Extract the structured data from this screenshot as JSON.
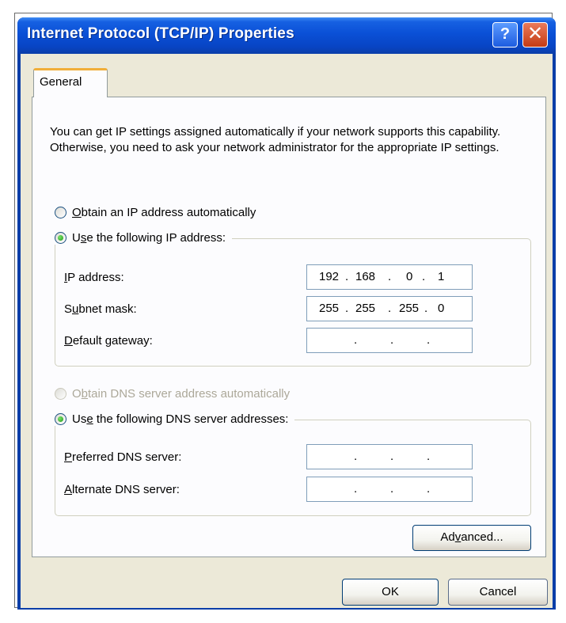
{
  "window": {
    "title": "Internet Protocol (TCP/IP) Properties",
    "help_glyph": "?",
    "close_glyph": "✕"
  },
  "tabs": [
    {
      "label": "General"
    }
  ],
  "description": "You can get IP settings assigned automatically if your network supports this capability. Otherwise, you need to ask your network administrator for the appropriate IP settings.",
  "ip": {
    "auto_label": {
      "pre": "",
      "key": "O",
      "post": "btain an IP address automatically"
    },
    "manual_label": {
      "pre": "U",
      "key": "s",
      "post": "e the following IP address:"
    },
    "fields": [
      {
        "label": {
          "pre": "",
          "key": "I",
          "post": "P address:"
        },
        "octets": [
          "192",
          "168",
          "0",
          "1"
        ]
      },
      {
        "label": {
          "pre": "S",
          "key": "u",
          "post": "bnet mask:"
        },
        "octets": [
          "255",
          "255",
          "255",
          "0"
        ]
      },
      {
        "label": {
          "pre": "",
          "key": "D",
          "post": "efault gateway:"
        },
        "octets": [
          "",
          "",
          "",
          ""
        ]
      }
    ]
  },
  "dns": {
    "auto_label": {
      "pre": "O",
      "key": "b",
      "post": "tain DNS server address automatically"
    },
    "manual_label": {
      "pre": "Us",
      "key": "e",
      "post": " the following DNS server addresses:"
    },
    "fields": [
      {
        "label": {
          "pre": "",
          "key": "P",
          "post": "referred DNS server:"
        },
        "octets": [
          "",
          "",
          "",
          ""
        ]
      },
      {
        "label": {
          "pre": "",
          "key": "A",
          "post": "lternate DNS server:"
        },
        "octets": [
          "",
          "",
          "",
          ""
        ]
      }
    ]
  },
  "buttons": {
    "advanced": {
      "pre": "Ad",
      "key": "v",
      "post": "anced..."
    },
    "ok": "OK",
    "cancel": "Cancel"
  },
  "colors": {
    "title_bar": "#0a50d6",
    "dialog_bg": "#ece9d8",
    "tab_highlight": "#f1ae39"
  }
}
